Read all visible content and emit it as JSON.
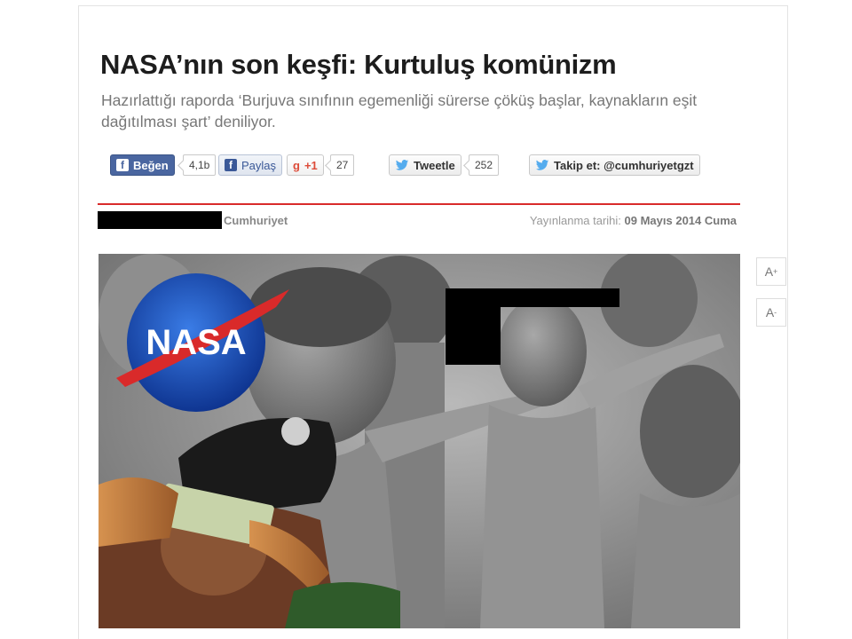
{
  "article": {
    "title": "NASA’nın son keşfi: Kurtuluş komünizm",
    "subtitle": "Hazırlattığı raporda ‘Burjuva sınıfının egemenliği sürerse çöküş başlar, kaynakların eşit dağıtılması şart’ deniliyor."
  },
  "share": {
    "like_label": "Beğen",
    "like_count": "4,1b",
    "share_label": "Paylaş",
    "gplus_label": "+1",
    "gplus_count": "27",
    "tweet_label": "Tweetle",
    "tweet_count": "252",
    "follow_label": "Takip et: @cumhuriyetgzt"
  },
  "meta": {
    "source": "Cumhuriyet",
    "published_label": "Yayınlanma tarihi:",
    "published_date": "09 Mayıs 2014 Cuma"
  },
  "photo": {
    "logo_text": "NASA"
  },
  "tools": {
    "font_increase": "A",
    "font_decrease": "A",
    "plus": "+",
    "minus": "-"
  },
  "colors": {
    "accent": "#d92b2b",
    "facebook": "#3b5998",
    "twitter": "#55acee",
    "gplus": "#dd4b39"
  },
  "icons": [
    "facebook-icon",
    "google-plus-icon",
    "twitter-icon"
  ]
}
